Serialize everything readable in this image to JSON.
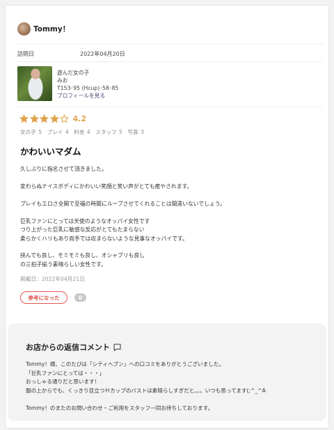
{
  "review": {
    "username": "Tommy！",
    "visit_label": "訪問日",
    "visit_date": "2022年04月20日",
    "profile": {
      "played_with": "遊んだ女の子",
      "girl_name": "みお",
      "stats": "T153･95 (Hcup)･58･85",
      "link": "プロフィールを見る"
    },
    "rating": {
      "stars_filled": 4,
      "stars_total": 5,
      "value": "4.2"
    },
    "scores_line": "女の子 5　プレイ 4　料金 4　スタッフ 5　写真 3",
    "title": "かわいいマダム",
    "body": [
      "久しぶりに指名させて頂きました。",
      "",
      "変わらぬナイスボディにかわいい笑顔と笑い声がとても癒やされます。",
      "",
      "プレイもエロさ全開で至福の時間にループさせてくれることは間違いないでしょう。",
      "",
      "巨乳ファンにとっては天使のようなオッパイ女性です",
      "つり上がった巨乳に敏感な反応がとてもたまらない",
      "柔らかくハリもあり両手では収まらないような見事なオッパイです。",
      "",
      "挟んでも良し、モミモミも良し、オシャブリも良し",
      "の三拍子揃う素晴らしい女性です。"
    ],
    "posted": "掲載日：2022年04月21日",
    "helpful_label": "参考になった",
    "helpful_count": "0"
  },
  "reply": {
    "title": "お店からの返信コメント",
    "lines": [
      "Tommy！様、このたびは「シティヘブン」への口コミをありがとうございました。",
      "「巨乳ファンにとっては・・・」",
      "おっしゃる通りだと思います！",
      "服の上からでも、くっきり目立つＨカップのバストは素晴らしすぎだと。。。いつも思ってます(;^_^A",
      "",
      "Tommy！のまたのお問い合わせ・ご利用をスタッフ一同お待ちしております。"
    ]
  },
  "colors": {
    "star": "#e0a24c",
    "accent": "#e0554f",
    "reply_bg": "#f3f3f3"
  },
  "icons": [
    "avatar",
    "star-icon",
    "speech-bubble-icon"
  ]
}
